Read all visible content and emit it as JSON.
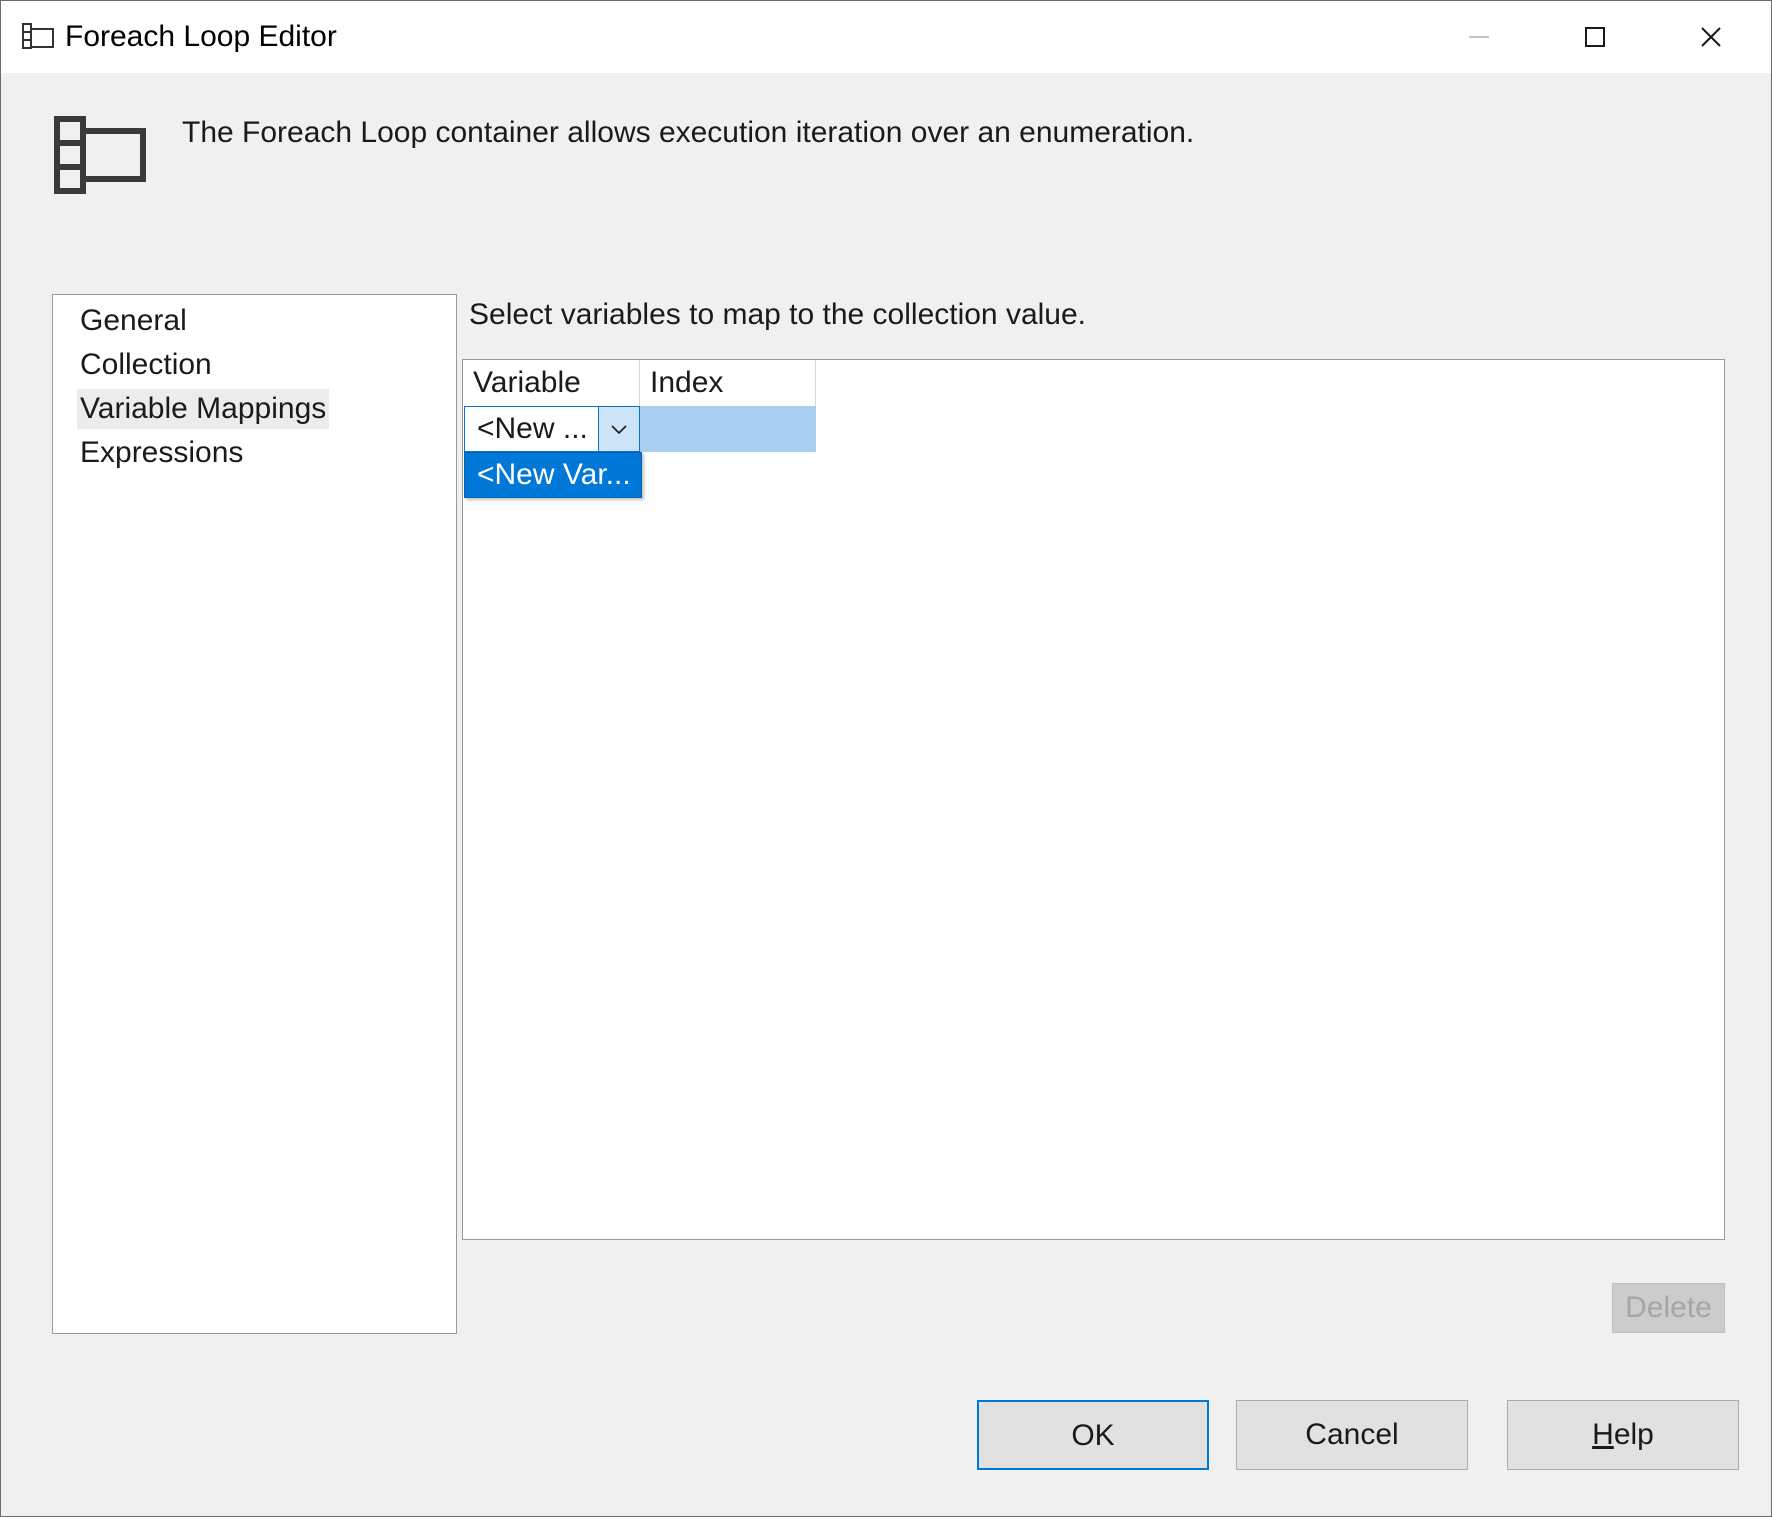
{
  "window": {
    "title": "Foreach Loop Editor",
    "icon": "foreach-loop-icon",
    "controls": [
      "minimize-icon",
      "maximize-icon",
      "close-icon"
    ]
  },
  "header": {
    "description": "The Foreach Loop container allows execution iteration over an enumeration.",
    "icon": "foreach-loop-icon"
  },
  "nav": {
    "items": [
      {
        "label": "General"
      },
      {
        "label": "Collection"
      },
      {
        "label": "Variable Mappings",
        "selected": true
      },
      {
        "label": "Expressions"
      }
    ]
  },
  "main": {
    "instruction": "Select variables to map to the collection value.",
    "grid": {
      "columns": [
        "Variable",
        "Index"
      ],
      "rows": [
        {
          "variable": "<New ...",
          "index": ""
        }
      ],
      "dropdown_options": [
        "<New Var..."
      ]
    },
    "delete_label": "Delete"
  },
  "buttons": {
    "ok": "OK",
    "cancel": "Cancel",
    "help_mnemonic": "H",
    "help_rest": "elp"
  },
  "colors": {
    "accent": "#0078d7",
    "selection_light": "#a9cff0",
    "window_bg": "#f0f0f0"
  }
}
